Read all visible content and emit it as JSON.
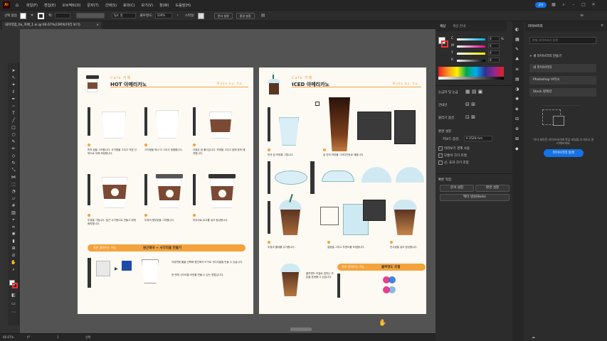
{
  "menubar": {
    "logo": "Ai",
    "items": [
      "파일(F)",
      "편집(E)",
      "오브젝트(O)",
      "문자(T)",
      "선택(S)",
      "효과(C)",
      "보기(V)",
      "창(W)",
      "도움말(H)"
    ],
    "share": "공유"
  },
  "controlbar": {
    "selection_label": "선택 없음",
    "stroke_label": "획:",
    "brush_value": "5pt. 원",
    "opacity_label": "불투명도:",
    "opacity_value": "100%",
    "style_label": "스타일:",
    "doc_setup": "문서 설정",
    "prefs": "환경 설정"
  },
  "document_tab": {
    "title": "내지작업_0a_카페_1.ai @ 66.67%(CMYK/미리 보기)",
    "close": "×"
  },
  "statusbar": {
    "zoom": "66.67%",
    "angle": "0°",
    "page": "1",
    "tool": "선택"
  },
  "colors": {
    "orange": "#f4a23b",
    "accent_blue": "#1473e6",
    "artboard_bg": "#fdfaf3"
  },
  "artboard1": {
    "brand": "Cafe 카페",
    "title": "HOT 아메리카노",
    "made_by": "Made by. 0a",
    "step1_text": "먼저 컵을 그려봅니다. 사각형을 그리고 직접 선택으로 아래 조정합니다.",
    "step2_text": "사각형을 하나 더 그리고 정렬합니다.",
    "step3_text": "다음은 컵 홀더입니다. 모양을 그리고 컵에 맞게 배치합니다.",
    "step4_text": "뚜껑을 그립니다. 둥근 사각형으로 만들고 위에 배치합니다.",
    "step5_text": "뚜껑의 윗부분을 그려줍니다.",
    "step6_text": "마무리로 로고를 넣어 완성합니다.",
    "tip_badge": "작은 알아두는 기능",
    "tip_title": "원근왜곡 + 사다리꼴 만들기",
    "tip_text1": "자유변형 툴을 선택해 원근왜곡 도구로 사다리꼴을 만들 수 있습니다.",
    "tip_text2": "한 번에 사다리꼴 모양을 만들 수 있는 방법입니다."
  },
  "artboard2": {
    "brand": "Cafe 카페",
    "title": "ICED 아메리카노",
    "made_by": "Made by. 0a",
    "step1_text": "먼저 컵 모양을 그립니다.",
    "step2_text": "컵 안의 커피를 그라디언트로 채웁니다.",
    "step3_text": "뚜껑과 빨대를 추가합니다.",
    "step4_text": "얼음을 그리고 투명도를 조정합니다.",
    "step5_text": "반사광을 넣어 완성합니다.",
    "tip_badge": "작은 알아두는 기능",
    "tip_title": "불투명도 조절",
    "tip_text": "불투명도 조절로 겹치는 부분을 표현할 수 있습니다."
  },
  "color_panel": {
    "tabs": [
      "색상",
      "색상 안내"
    ],
    "channels": [
      {
        "label": "C",
        "value": "0"
      },
      {
        "label": "M",
        "value": "0"
      },
      {
        "label": "Y",
        "value": "0"
      },
      {
        "label": "K",
        "value": "0"
      }
    ],
    "hex_label": "%"
  },
  "properties_panel": {
    "transform_label": "눈금자 및 눈금",
    "align_label": "안내선",
    "snap_label": "물리기 옵션",
    "prefs_title": "환경 설정",
    "key_increment_label": "키보드 증감:",
    "key_increment_value": "0.3528 mm",
    "check1": "미리보기 경계 사용",
    "check2": "모퉁이 크기 조절",
    "check3": "선, 효과 크기 조정",
    "quick_actions_title": "빠른 작업",
    "doc_setup_button": "문서 설정",
    "prefs_button": "환경 설정",
    "vector_button": "벡터 생성(Beta)"
  },
  "library_panel": {
    "title": "라이브러리",
    "search_placeholder": "현재 라이브러리 검색",
    "new_library": "+ 새 라이브러리 만들기",
    "items": [
      "내 라이브러리",
      "Photoshop 브러시",
      "Stock 컬렉션"
    ],
    "empty_text": "이미 제작된 라이브러리에 작업 파일을 추가하고 관리해보세요.",
    "explore_button": "라이브러리 탐색"
  }
}
